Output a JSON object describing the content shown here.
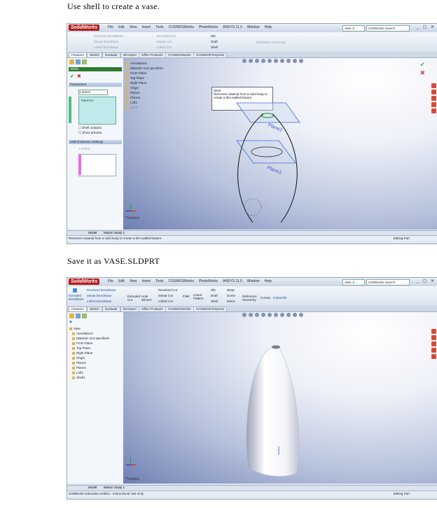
{
  "captions": {
    "step1": "Use shell to create a vase.",
    "step2": "Save it as VASE.SLDPRT"
  },
  "app": {
    "logo": "SolidWorks",
    "menus": [
      "File",
      "Edit",
      "View",
      "Insert",
      "Tools",
      "COSMOSWorks",
      "PhotoWorks",
      "ANSYS 11.0",
      "Window",
      "Help"
    ],
    "search_placeholder": "SolidWorks Search",
    "doc_search": "Vase S..."
  },
  "ribbon": {
    "extruded": "Extruded Boss/Base",
    "revolved_boss": "Revolved Boss/Base",
    "swept_boss": "Swept Boss/Base",
    "lofted_boss": "Lofted Boss/Base",
    "extruded_cut": "Extruded Cut",
    "hole_wizard": "Hole Wizard",
    "revolved_cut": "Revolved Cut",
    "swept_cut": "Swept Cut",
    "lofted_cut": "Lofted Cut",
    "fillet": "Fillet",
    "linear_pattern": "Linear Pattern",
    "rib": "Rib",
    "draft": "Draft",
    "shell": "Shell",
    "wrap": "Wrap",
    "dome": "Dome",
    "mirror": "Mirror",
    "ref_geometry": "Reference Geometry",
    "curves": "Curves",
    "instant3d": "Instant3D"
  },
  "tabs": [
    "Features",
    "Sketch",
    "Evaluate",
    "DimXpert",
    "Office Products",
    "COSMOSWorks",
    "COSMOSFloXpress"
  ],
  "tooltip": {
    "title": "Shell",
    "body": "Removes material from a solid body to create a thin-walled feature."
  },
  "shell_pm": {
    "title": "Shell1",
    "parameters": "Parameters",
    "thickness": "1.00mm",
    "face": "Face<1>",
    "shell_outward": "Shell outward",
    "show_preview": "Show preview",
    "multi_thickness": "Multi-thickness Settings",
    "multi_value": "1.00mm"
  },
  "tree1": [
    "Annotations",
    "Material <not specified>",
    "Front Plane",
    "Top Plane",
    "Right Plane",
    "Origin",
    "Plane1",
    "Plane2",
    "Loft1",
    "Shell"
  ],
  "tree2": [
    "Vase",
    "Annotations",
    "Material <not specified>",
    "Front Plane",
    "Top Plane",
    "Right Plane",
    "Origin",
    "Plane1",
    "Plane2",
    "Loft1",
    "Shell1"
  ],
  "viewport": {
    "plane1": "Plane1",
    "plane2": "Plane2",
    "view_label": "*Trimetric"
  },
  "bottom_tabs": [
    "Model",
    "Motion Study 1"
  ],
  "status1": {
    "left": "Removes material from a solid body to create a thin-walled feature.",
    "right": "Editing Part"
  },
  "status2": {
    "left": "SolidWorks Education Edition - Instructional Use Only",
    "right": "Editing Part"
  }
}
